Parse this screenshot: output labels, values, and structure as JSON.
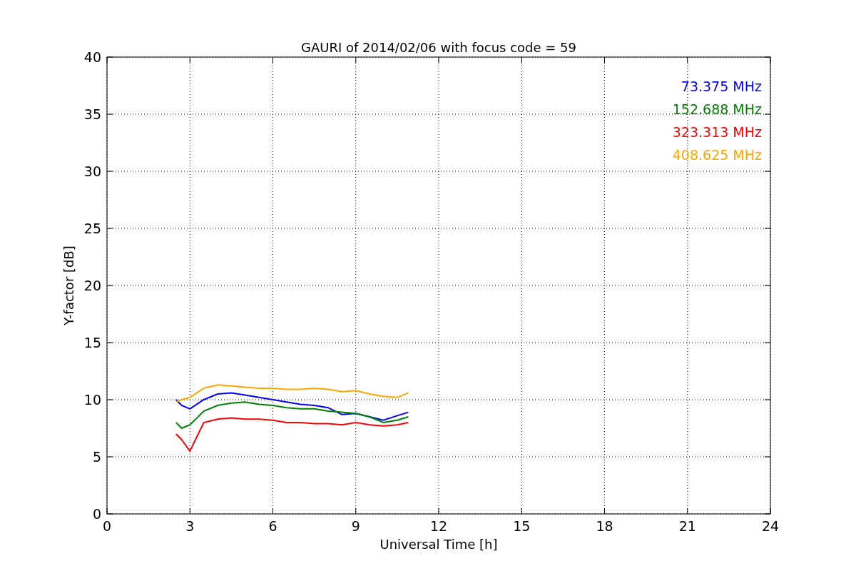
{
  "figure": {
    "chart_data": {
      "type": "line",
      "title": "GAURI of 2014/02/06 with focus code = 59",
      "xlabel": "Universal Time [h]",
      "ylabel": "Y-factor [dB]",
      "x": [
        2.5,
        2.7,
        3,
        3.5,
        4,
        4.5,
        5,
        5.5,
        6,
        6.5,
        7,
        7.5,
        8,
        8.5,
        9,
        9.5,
        10,
        10.5,
        10.9
      ],
      "series": [
        {
          "name": "73.375 MHz",
          "color": "#0000ff",
          "values": [
            10,
            9.5,
            9.2,
            10,
            10.5,
            10.6,
            10.4,
            10.2,
            10,
            9.8,
            9.6,
            9.5,
            9.3,
            8.7,
            8.8,
            8.5,
            8.2,
            8.6,
            8.9
          ]
        },
        {
          "name": "152.688 MHz",
          "color": "#008000",
          "values": [
            8,
            7.5,
            7.8,
            9,
            9.5,
            9.7,
            9.8,
            9.6,
            9.5,
            9.3,
            9.2,
            9.2,
            9,
            8.9,
            8.8,
            8.5,
            8,
            8.2,
            8.5
          ]
        },
        {
          "name": "323.313 MHz",
          "color": "#ff0000",
          "values": [
            7,
            6.5,
            5.5,
            8,
            8.3,
            8.4,
            8.3,
            8.3,
            8.2,
            8,
            8,
            7.9,
            7.9,
            7.8,
            8,
            7.8,
            7.7,
            7.8,
            8
          ]
        },
        {
          "name": "408.625 MHz",
          "color": "#ffa500",
          "values": [
            9.8,
            10,
            10.2,
            11,
            11.3,
            11.2,
            11.1,
            11,
            11,
            10.9,
            10.9,
            11,
            10.9,
            10.7,
            10.8,
            10.5,
            10.3,
            10.2,
            10.6
          ]
        }
      ],
      "grid": true,
      "xlim": [
        0,
        24
      ],
      "ylim": [
        0,
        40
      ],
      "xticks": [
        0,
        3,
        6,
        9,
        12,
        15,
        18,
        21,
        24
      ],
      "yticks": [
        0,
        5,
        10,
        15,
        20,
        25,
        30,
        35,
        40
      ]
    }
  }
}
